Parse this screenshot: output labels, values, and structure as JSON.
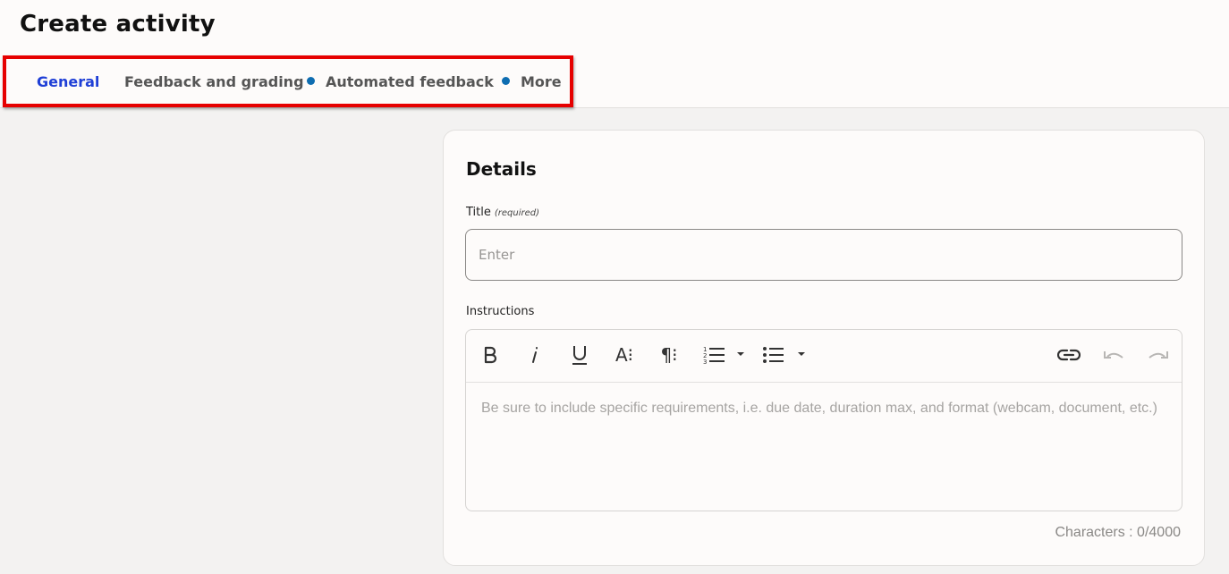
{
  "page": {
    "title": "Create activity"
  },
  "tabs": [
    {
      "label": "General",
      "active": true,
      "dot": false
    },
    {
      "label": "Feedback and grading",
      "active": false,
      "dot": false
    },
    {
      "label": "Automated feedback",
      "active": false,
      "dot": true
    },
    {
      "label": "More",
      "active": false,
      "dot": true
    }
  ],
  "details": {
    "heading": "Details",
    "title_label": "Title",
    "title_required": "(required)",
    "title_placeholder": "Enter",
    "instructions_label": "Instructions",
    "instructions_placeholder": "Be sure to include specific requirements, i.e. due date, duration max, and format (webcam, document, etc.)",
    "char_count": "Characters : 0/4000"
  },
  "toolbar": {
    "buttons": [
      "bold",
      "italic",
      "underline",
      "font-size",
      "paragraph-format",
      "ordered-list",
      "unordered-list",
      "link",
      "undo",
      "redo"
    ]
  },
  "colors": {
    "accent": "#1f3fd6",
    "highlight_box": "#e60000",
    "dot": "#0e6db1"
  }
}
